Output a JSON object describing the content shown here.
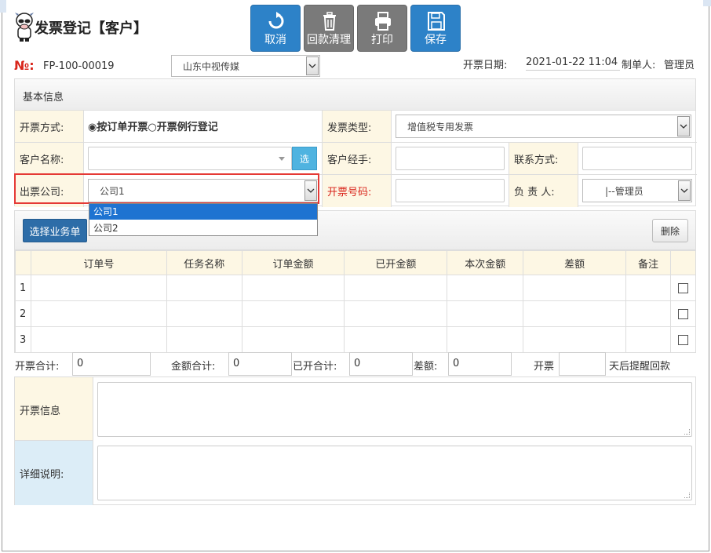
{
  "header": {
    "title": "发票登记【客户】"
  },
  "toolbar": [
    {
      "label": "取消",
      "icon": "undo-icon",
      "color": "#2d82c8"
    },
    {
      "label": "回款清理",
      "icon": "trash-icon",
      "color": "#7a7a7a"
    },
    {
      "label": "打印",
      "icon": "printer-icon",
      "color": "#7a7a7a"
    },
    {
      "label": "保存",
      "icon": "save-icon",
      "color": "#2d82c8"
    }
  ],
  "meta": {
    "no_label": "№:",
    "no_value": "FP-100-00019",
    "customer_select": "山东中视传媒",
    "date_label": "开票日期:",
    "date_value": "2021-01-22 11:04",
    "maker_label": "制单人:",
    "maker_value": "管理员"
  },
  "basic": {
    "section_title": "基本信息",
    "method_label": "开票方式:",
    "method_options": [
      "按订单开票",
      "开票例行登记"
    ],
    "method_selected": "按订单开票",
    "invoice_type_label": "发票类型:",
    "invoice_type_value": "增值税专用发票",
    "customer_name_label": "客户名称:",
    "customer_name_value": "",
    "select_button": "选",
    "customer_handler_label": "客户经手:",
    "customer_handler_value": "",
    "contact_label": "联系方式:",
    "contact_value": "",
    "issuer_label": "出票公司:",
    "issuer_value": "公司1",
    "invoice_no_label": "开票号码:",
    "invoice_no_value": "",
    "owner_label": "负 责 人:",
    "owner_value": "|--管理员"
  },
  "issuer_dropdown": {
    "options": [
      "公司1",
      "公司2"
    ],
    "selected_index": 0
  },
  "orders": {
    "pick_button": "选择业务单",
    "delete_button": "删除",
    "columns": [
      "订单号",
      "任务名称",
      "订单金额",
      "已开金额",
      "本次金额",
      "差额",
      "备注"
    ],
    "rows": [
      {
        "num": "1",
        "cells": [
          "",
          "",
          "",
          "",
          "",
          "",
          ""
        ],
        "checked": false
      },
      {
        "num": "2",
        "cells": [
          "",
          "",
          "",
          "",
          "",
          "",
          ""
        ],
        "checked": false
      },
      {
        "num": "3",
        "cells": [
          "",
          "",
          "",
          "",
          "",
          "",
          ""
        ],
        "checked": false
      }
    ]
  },
  "totals": {
    "invoice_total_label": "开票合计:",
    "invoice_total": "0",
    "amount_total_label": "金额合计:",
    "amount_total": "0",
    "opened_total_label": "已开合计:",
    "opened_total": "0",
    "diff_label": "差额:",
    "diff": "0",
    "remind_prefix": "开票",
    "remind_days": "",
    "remind_suffix": "天后提醒回款"
  },
  "details": {
    "invoice_info_label": "开票信息",
    "invoice_info_value": "",
    "detail_label": "详细说明:",
    "detail_value": ""
  }
}
